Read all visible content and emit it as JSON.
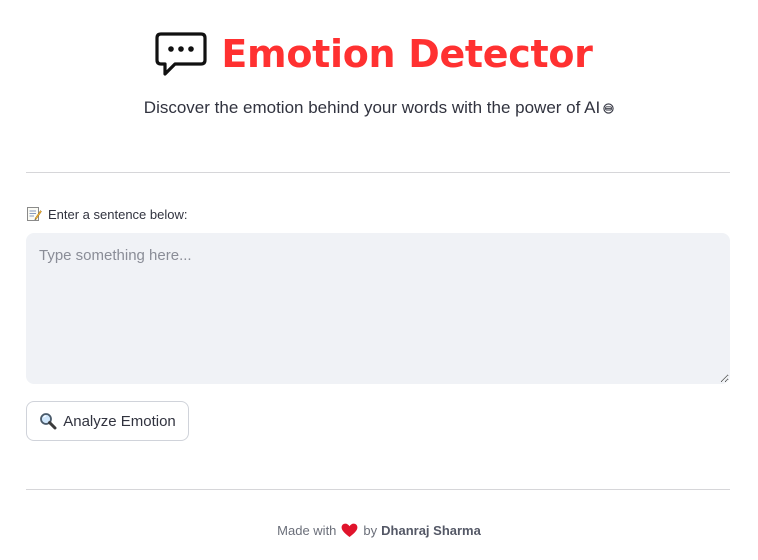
{
  "header": {
    "icon": "speech-bubble-icon",
    "title": "Emotion Detector",
    "title_color": "#ff3131"
  },
  "subtitle": {
    "text": "Discover the emotion behind your words with the power of AI",
    "icon": "robot-face-icon"
  },
  "input": {
    "label_icon": "memo-icon",
    "label": "Enter a sentence below:",
    "value": "",
    "placeholder": "Type something here..."
  },
  "analyze_button": {
    "icon": "magnifier-icon",
    "label": "Analyze Emotion"
  },
  "footer": {
    "prefix": "Made with",
    "icon": "heart-icon",
    "by": "by",
    "author": "Dhanraj Sharma",
    "heart_color": "#e0142c"
  }
}
